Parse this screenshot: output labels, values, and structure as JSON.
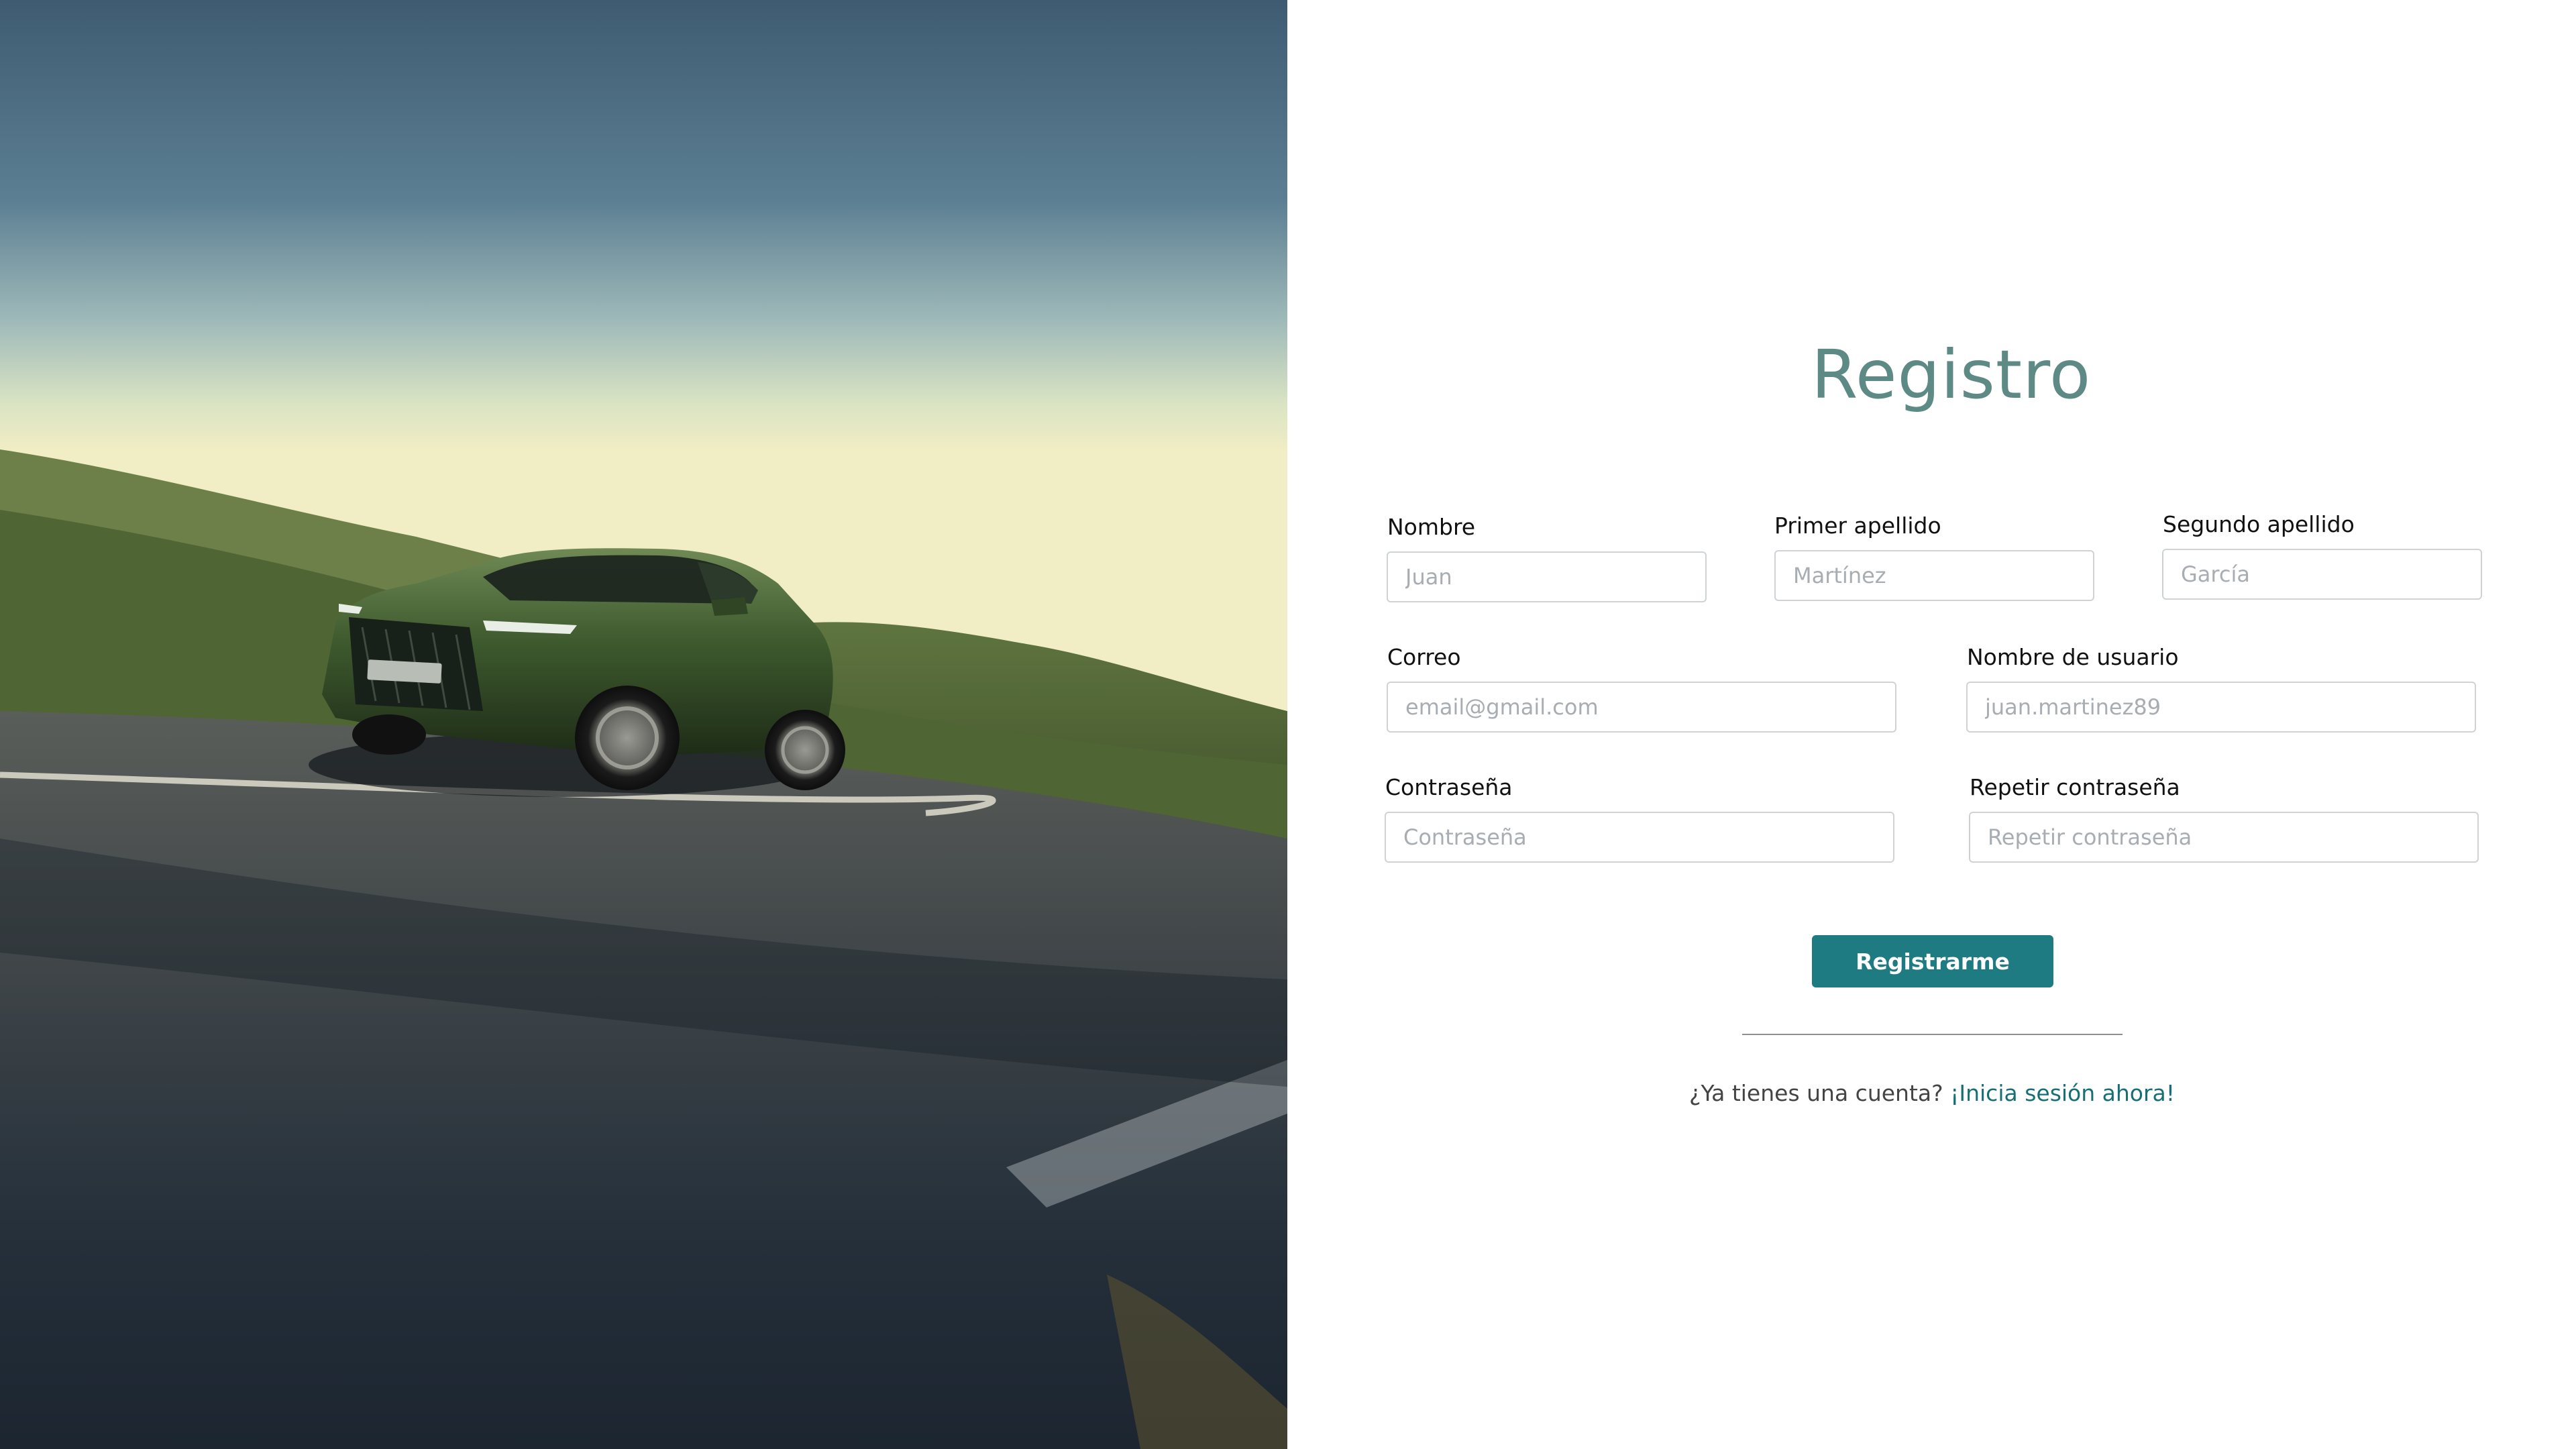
{
  "hero": {
    "image_description_icon": "car-road-photo"
  },
  "form": {
    "title": "Registro",
    "fields": {
      "nombre": {
        "label": "Nombre",
        "placeholder": "Juan"
      },
      "primer_apellido": {
        "label": "Primer apellido",
        "placeholder": "Martínez"
      },
      "segundo_apellido": {
        "label": "Segundo apellido",
        "placeholder": "García"
      },
      "correo": {
        "label": "Correo",
        "placeholder": "email@gmail.com"
      },
      "usuario": {
        "label": "Nombre de usuario",
        "placeholder": "juan.martinez89"
      },
      "contrasena": {
        "label": "Contraseña",
        "placeholder": "Contraseña"
      },
      "repetir": {
        "label": "Repetir contraseña",
        "placeholder": "Repetir contraseña"
      }
    },
    "submit_label": "Registrarme",
    "login_prompt": "¿Ya tienes una cuenta?",
    "login_link": "¡Inicia sesión ahora!"
  },
  "colors": {
    "title": "#5d8a84",
    "button": "#1f7b82",
    "link": "#166f74"
  }
}
